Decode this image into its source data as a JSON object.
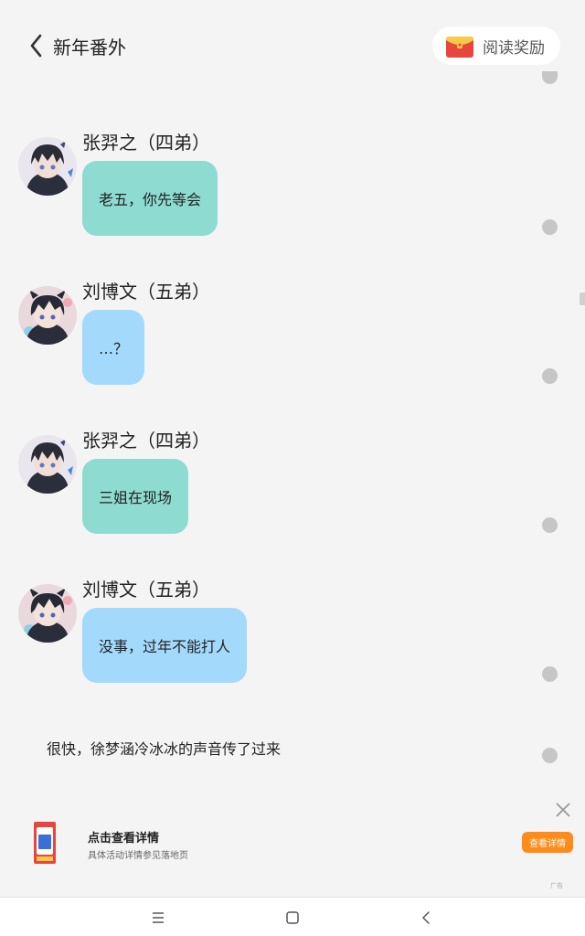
{
  "header": {
    "title": "新年番外",
    "back_icon": "chevron-left-icon",
    "reward_label": "阅读奖励",
    "reward_icon": "red-envelope-icon"
  },
  "messages": [
    {
      "name": "张羿之（四弟）",
      "text": "老五，你先等会",
      "bubble_color": "#8ddbd1"
    },
    {
      "name": "刘博文（五弟）",
      "text": "…？",
      "bubble_color": "#a3dafb"
    },
    {
      "name": "张羿之（四弟）",
      "text": "三姐在现场",
      "bubble_color": "#8ddbd1"
    },
    {
      "name": "刘博文（五弟）",
      "text": "没事，过年不能打人",
      "bubble_color": "#a3dafb"
    }
  ],
  "narration": "很快，徐梦涵冷冰冰的声音传了过来",
  "ad": {
    "title": "点击查看详情",
    "subtitle": "具体活动详情参见落地页",
    "button": "查看详情",
    "tag": "广告"
  },
  "navbar": {
    "icons": [
      "menu-icon",
      "home-square-icon",
      "back-chevron-icon"
    ]
  },
  "colors": {
    "background": "#f4f4f4",
    "teal_bubble": "#8ddbd1",
    "blue_bubble": "#a3dafb",
    "ad_button": "#ff8c1a"
  }
}
